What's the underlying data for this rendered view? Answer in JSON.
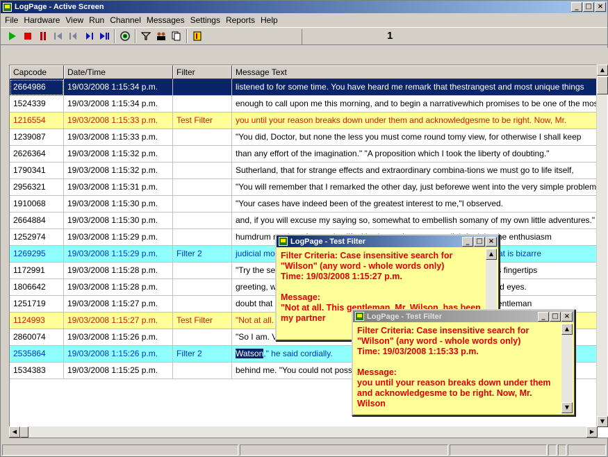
{
  "window": {
    "title": "LogPage - Active Screen"
  },
  "menu": [
    "File",
    "Hardware",
    "View",
    "Run",
    "Channel",
    "Messages",
    "Settings",
    "Reports",
    "Help"
  ],
  "toolbar": {
    "counter": "1"
  },
  "columns": [
    "Capcode",
    "Date/Time",
    "Filter",
    "Message Text"
  ],
  "rows": [
    {
      "capcode": "2664986",
      "datetime": "19/03/2008 1:15:34 p.m.",
      "filter": "",
      "message": "listened to for some time. You have heard me remark that thestrangest and most unique things",
      "style": "sel"
    },
    {
      "capcode": "1524339",
      "datetime": "19/03/2008 1:15:34 p.m.",
      "filter": "",
      "message": "enough to call upon me this morning, and to begin a narrativewhich promises to be one of the most",
      "style": ""
    },
    {
      "capcode": "1216554",
      "datetime": "19/03/2008 1:15:33 p.m.",
      "filter": "Test Filter",
      "message": "you until your reason breaks down under them and acknowledgesme to be right. Now, Mr.",
      "style": "yellow"
    },
    {
      "capcode": "1239087",
      "datetime": "19/03/2008 1:15:33 p.m.",
      "filter": "",
      "message": "\"You did, Doctor, but none the less you must come round tomy view, for otherwise I shall keep",
      "style": ""
    },
    {
      "capcode": "2626364",
      "datetime": "19/03/2008 1:15:32 p.m.",
      "filter": "",
      "message": "than any effort of the imagination.\"  \"A proposition which I took the liberty of doubting.\"",
      "style": ""
    },
    {
      "capcode": "1790341",
      "datetime": "19/03/2008 1:15:32 p.m.",
      "filter": "",
      "message": "Sutherland, that for strange effects and extraordinary combina-tions we must go to life itself,",
      "style": ""
    },
    {
      "capcode": "2956321",
      "datetime": "19/03/2008 1:15:31 p.m.",
      "filter": "",
      "message": "\"You will remember that I remarked the other day, just beforewe went into the very simple problem",
      "style": ""
    },
    {
      "capcode": "1910068",
      "datetime": "19/03/2008 1:15:30 p.m.",
      "filter": "",
      "message": "\"Your cases have indeed been of the greatest interest to me,\"I observed.",
      "style": ""
    },
    {
      "capcode": "2664884",
      "datetime": "19/03/2008 1:15:30 p.m.",
      "filter": "",
      "message": "and, if you will excuse my saying so, somewhat to embellish somany of my own little adventures.\"",
      "style": ""
    },
    {
      "capcode": "1252974",
      "datetime": "19/03/2008 1:15:29 p.m.",
      "filter": "",
      "message": "humdrum routine of everyday life. You have shown your relish for it by the enthusiasm",
      "style": ""
    },
    {
      "capcode": "1269295",
      "datetime": "19/03/2008 1:15:29 p.m.",
      "filter": "Filter 2",
      "message": "judicial mood. \"I know, my dear Watson, that you share my love of all that is bizarre",
      "style": "cyan"
    },
    {
      "capcode": "1172991",
      "datetime": "19/03/2008 1:15:28 p.m.",
      "filter": "",
      "message": "\"Try the settee,\" said Holmes, relapsing into his armchair and putting his fingertips",
      "style": ""
    },
    {
      "capcode": "1806642",
      "datetime": "19/03/2008 1:15:28 p.m.",
      "filter": "",
      "message": "greeting, with a quick little questioning glance from his small fat-encircled eyes.",
      "style": ""
    },
    {
      "capcode": "1251719",
      "datetime": "19/03/2008 1:15:27 p.m.",
      "filter": "",
      "message": "doubt that he will be of the utmost use to me in yours also.\"  The stout gentleman",
      "style": ""
    },
    {
      "capcode": "1124993",
      "datetime": "19/03/2008 1:15:27 p.m.",
      "filter": "Test Filter",
      "message": "\"Not at all. This gentleman, Mr. Wilson, has been my partner and helper in many of",
      "style": "yellow"
    },
    {
      "capcode": "2860074",
      "datetime": "19/03/2008 1:15:26 p.m.",
      "filter": "",
      "message": "\"So I am. Very much so.\"",
      "style": ""
    },
    {
      "capcode": "2535864",
      "datetime": "19/03/2008 1:15:26 p.m.",
      "filter": "Filter 2",
      "message_hl": "Watson",
      "message": ",\" he said cordially.",
      "style": "cyan"
    },
    {
      "capcode": "1534383",
      "datetime": "19/03/2008 1:15:25 p.m.",
      "filter": "",
      "message": "behind me.  \"You could not possibly have come at a better time, my dear",
      "style": ""
    }
  ],
  "popup1": {
    "title": "LogPage - Test Filter",
    "criteria": "Filter Criteria: Case insensitive search for \"Wilson\" (any word - whole words only)",
    "time": "Time: 19/03/2008 1:15:27 p.m.",
    "message_label": "Message:",
    "message": "\"Not at all. This gentleman, Mr. Wilson, has been my partner"
  },
  "popup2": {
    "title": "LogPage - Test Filter",
    "criteria": "Filter Criteria: Case insensitive search for \"Wilson\" (any word - whole words only)",
    "time": "Time: 19/03/2008 1:15:33 p.m.",
    "message_label": "Message:",
    "message": "you until your reason breaks down under them and acknowledgesme to be right. Now, Mr. Wilson"
  }
}
